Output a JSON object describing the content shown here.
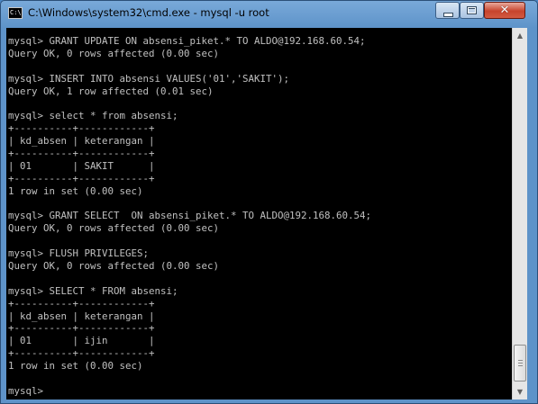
{
  "window": {
    "title": "C:\\Windows\\system32\\cmd.exe - mysql  -u root",
    "icon_text": "C:\\",
    "controls": {
      "minimize": "minimize-icon",
      "maximize": "maximize-icon",
      "close": "close-icon",
      "close_glyph": "✕"
    }
  },
  "console": {
    "lines": [
      "mysql> GRANT UPDATE ON absensi_piket.* TO ALDO@192.168.60.54;",
      "Query OK, 0 rows affected (0.00 sec)",
      "",
      "mysql> INSERT INTO absensi VALUES('01','SAKIT');",
      "Query OK, 1 row affected (0.01 sec)",
      "",
      "mysql> select * from absensi;",
      "+----------+------------+",
      "| kd_absen | keterangan |",
      "+----------+------------+",
      "| 01       | SAKIT      |",
      "+----------+------------+",
      "1 row in set (0.00 sec)",
      "",
      "mysql> GRANT SELECT  ON absensi_piket.* TO ALDO@192.168.60.54;",
      "Query OK, 0 rows affected (0.00 sec)",
      "",
      "mysql> FLUSH PRIVILEGES;",
      "Query OK, 0 rows affected (0.00 sec)",
      "",
      "mysql> SELECT * FROM absensi;",
      "+----------+------------+",
      "| kd_absen | keterangan |",
      "+----------+------------+",
      "| 01       | ijin       |",
      "+----------+------------+",
      "1 row in set (0.00 sec)",
      "",
      "mysql>"
    ]
  },
  "scrollbar": {
    "up_arrow": "▲",
    "down_arrow": "▼"
  },
  "colors": {
    "console_bg": "#000000",
    "console_text": "#c0c0c0",
    "title_bar": "#5e93c9",
    "close_button": "#c7442d"
  }
}
